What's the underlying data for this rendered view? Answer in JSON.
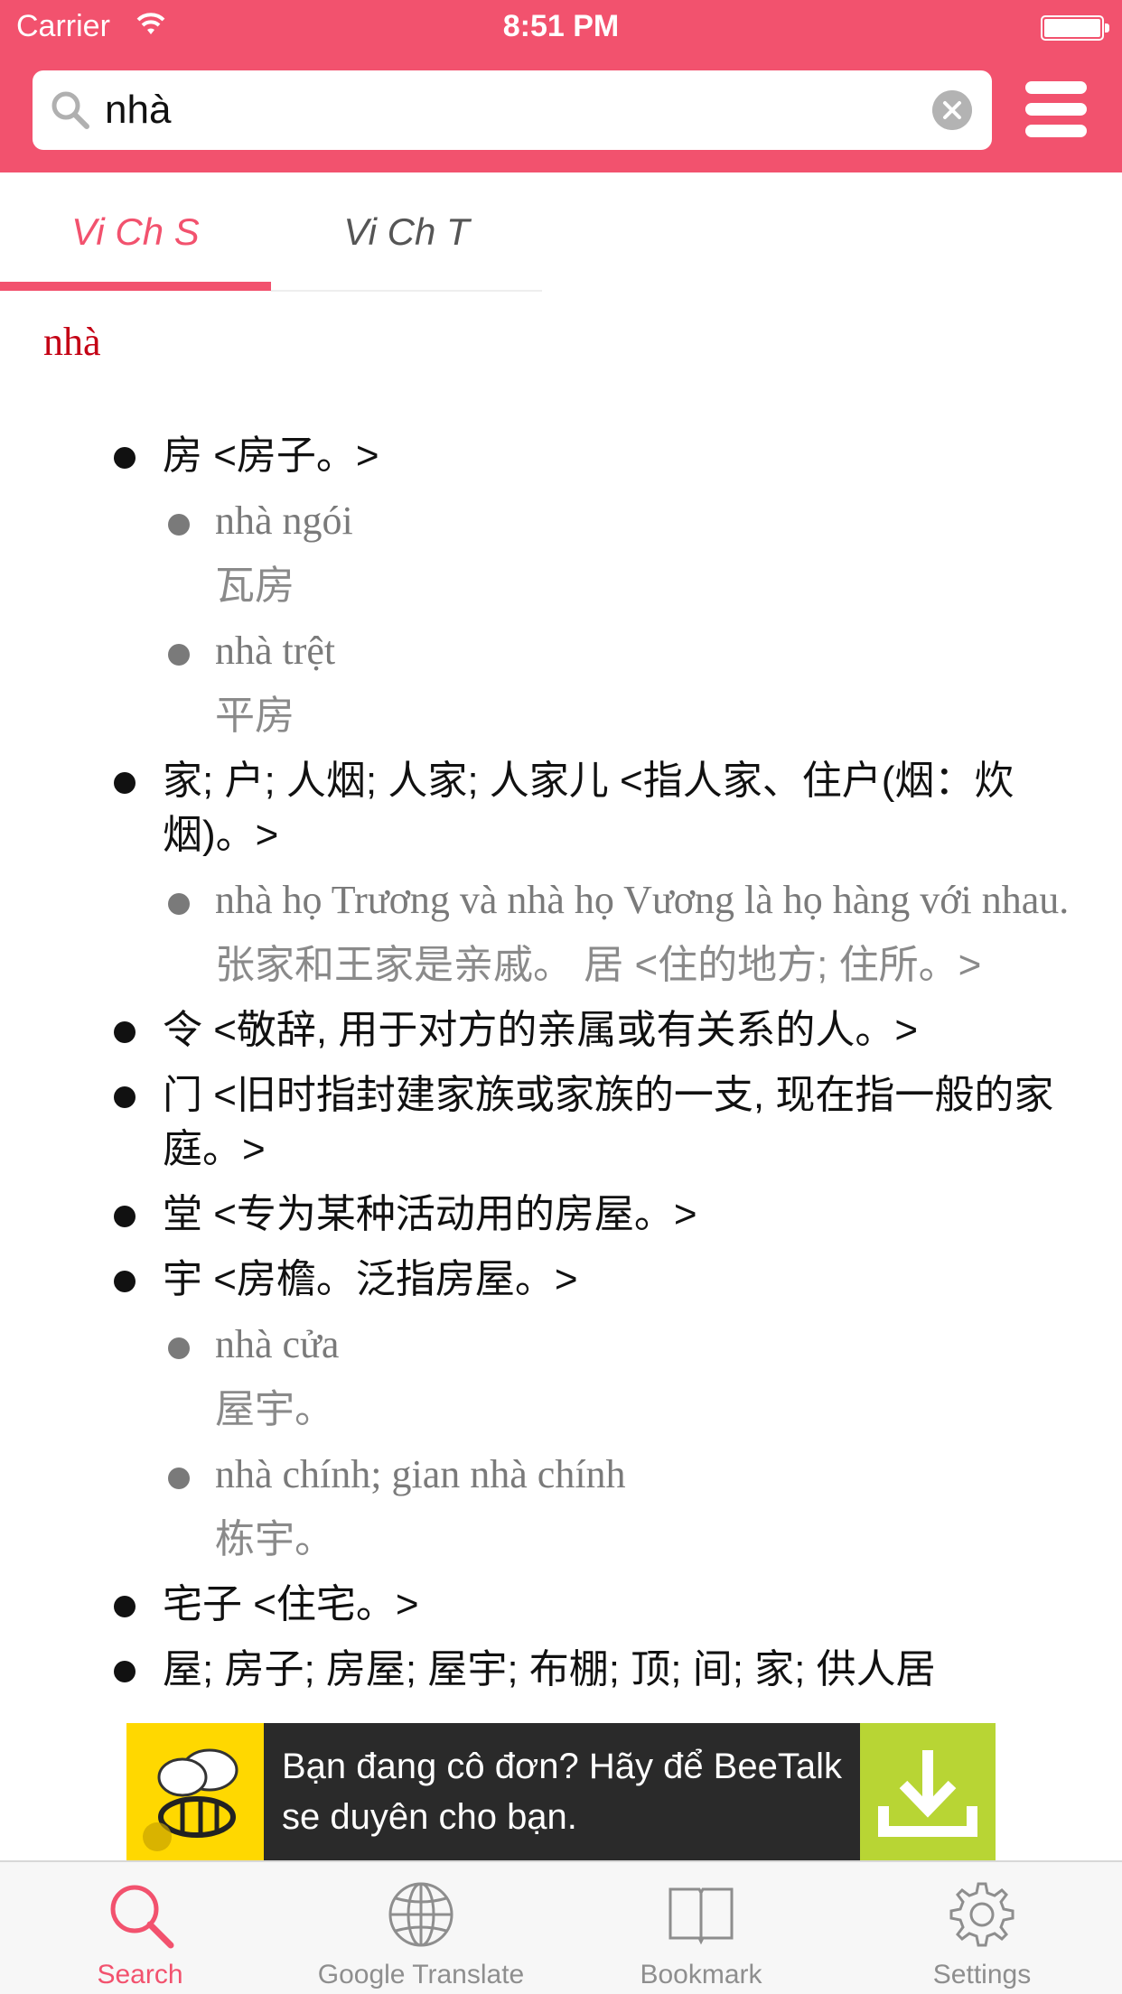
{
  "status_bar": {
    "carrier": "Carrier",
    "time": "8:51 PM"
  },
  "search": {
    "value": "nhà",
    "placeholder": ""
  },
  "tabs": [
    {
      "label": "Vi Ch S",
      "active": true
    },
    {
      "label": "Vi Ch T",
      "active": false
    }
  ],
  "content": {
    "headword": "nhà",
    "entries": [
      {
        "text": "房 <房子。>",
        "subs": [
          {
            "example": "nhà ngói",
            "translation": "瓦房"
          },
          {
            "example": "nhà trệt",
            "translation": "平房"
          }
        ]
      },
      {
        "text": "家; 户; 人烟; 人家; 人家儿 <指人家、住户(烟：炊烟)。>",
        "subs": [
          {
            "example": "nhà họ Trương và nhà họ Vương là họ hàng với nhau.",
            "translation": "张家和王家是亲戚。 居 <住的地方; 住所。>"
          }
        ]
      },
      {
        "text": "令 <敬辞, 用于对方的亲属或有关系的人。>",
        "subs": []
      },
      {
        "text": "门 <旧时指封建家族或家族的一支, 现在指一般的家庭。>",
        "subs": []
      },
      {
        "text": "堂 <专为某种活动用的房屋。>",
        "subs": []
      },
      {
        "text": "宇 <房檐。泛指房屋。>",
        "subs": [
          {
            "example": "nhà cửa",
            "translation": "屋宇。"
          },
          {
            "example": "nhà chính; gian nhà chính",
            "translation": "栋宇。"
          }
        ]
      },
      {
        "text": "宅子 <住宅。>",
        "subs": []
      },
      {
        "text": "屋; 房子; 房屋; 屋宇; 布棚; 顶; 间; 家; 供人居",
        "subs": []
      }
    ]
  },
  "ad": {
    "text": "Bạn đang cô đơn? Hãy để BeeTalk se duyên cho bạn."
  },
  "tabbar": [
    {
      "label": "Search",
      "icon": "search-icon",
      "active": true
    },
    {
      "label": "Google Translate",
      "icon": "globe-icon",
      "active": false
    },
    {
      "label": "Bookmark",
      "icon": "book-icon",
      "active": false
    },
    {
      "label": "Settings",
      "icon": "gear-icon",
      "active": false
    }
  ],
  "colors": {
    "accent": "#f2526e",
    "headword": "#c40014",
    "ad_download": "#b8d534",
    "ad_logo": "#ffd800"
  }
}
